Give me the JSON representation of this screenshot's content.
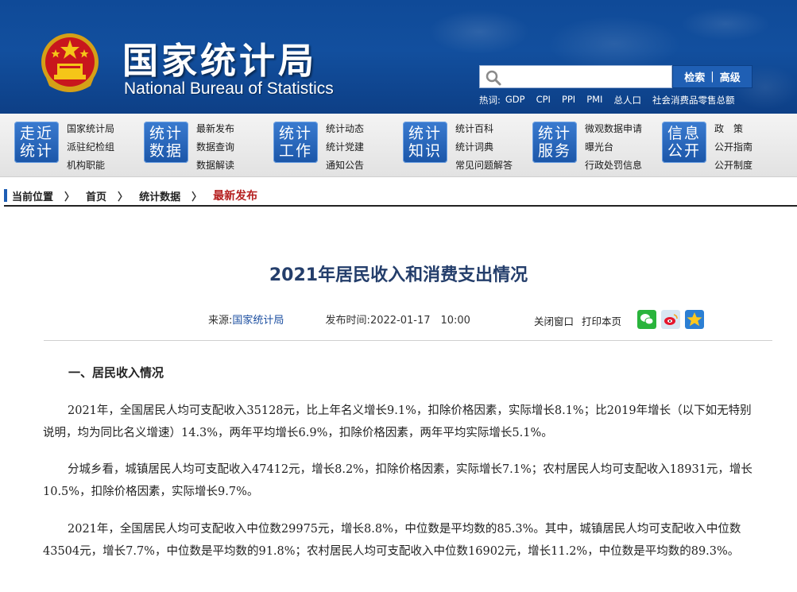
{
  "header": {
    "title_cn": "国家统计局",
    "title_en": "National Bureau of Statistics",
    "search": {
      "placeholder": "",
      "button_search": "检索",
      "button_advanced": "高级"
    },
    "hot_label": "热词:",
    "hot_words": [
      "GDP",
      "CPI",
      "PPI",
      "PMI",
      "总人口",
      "社会消费品零售总额"
    ]
  },
  "nav": [
    {
      "badge": [
        "走近",
        "统计"
      ],
      "links": [
        "国家统计局",
        "派驻纪检组",
        "机构职能"
      ]
    },
    {
      "badge": [
        "统计",
        "数据"
      ],
      "links": [
        "最新发布",
        "数据查询",
        "数据解读"
      ]
    },
    {
      "badge": [
        "统计",
        "工作"
      ],
      "links": [
        "统计动态",
        "统计党建",
        "通知公告"
      ]
    },
    {
      "badge": [
        "统计",
        "知识"
      ],
      "links": [
        "统计百科",
        "统计词典",
        "常见问题解答"
      ]
    },
    {
      "badge": [
        "统计",
        "服务"
      ],
      "links": [
        "微观数据申请",
        "曝光台",
        "行政处罚信息"
      ]
    },
    {
      "badge": [
        "信息",
        "公开"
      ],
      "links": [
        "政　策",
        "公开指南",
        "公开制度"
      ]
    }
  ],
  "breadcrumb": {
    "location_label": "当前位置",
    "items": [
      "首页",
      "统计数据"
    ],
    "current": "最新发布",
    "separator": "〉"
  },
  "article": {
    "title": "2021年居民收入和消费支出情况",
    "source_label": "来源:",
    "source": "国家统计局",
    "time_label": "发布时间:",
    "time": "2022-01-17　10:00",
    "close_label": "关闭窗口",
    "print_label": "打印本页",
    "section1": "一、居民收入情况",
    "paragraphs": [
      "2021年，全国居民人均可支配收入35128元，比上年名义增长9.1%，扣除价格因素，实际增长8.1%；比2019年增长（以下如无特别说明，均为同比名义增速）14.3%，两年平均增长6.9%，扣除价格因素，两年平均实际增长5.1%。",
      "分城乡看，城镇居民人均可支配收入47412元，增长8.2%，扣除价格因素，实际增长7.1%；农村居民人均可支配收入18931元，增长10.5%，扣除价格因素，实际增长9.7%。",
      "2021年，全国居民人均可支配收入中位数29975元，增长8.8%，中位数是平均数的85.3%。其中，城镇居民人均可支配收入中位数43504元，增长7.7%，中位数是平均数的91.8%；农村居民人均可支配收入中位数16902元，增长11.2%，中位数是平均数的89.3%。"
    ]
  },
  "colors": {
    "banner": "#124f9e",
    "nav_badge": "#1b56a8",
    "title": "#243e6b",
    "breadcrumb_current": "#b51f1f"
  }
}
